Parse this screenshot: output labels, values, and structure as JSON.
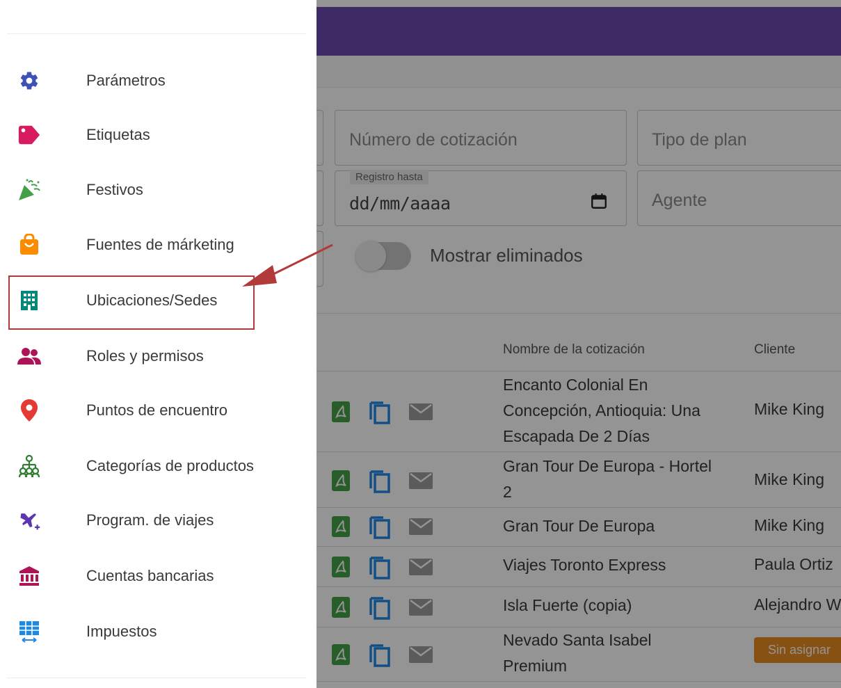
{
  "menu": {
    "items": [
      {
        "label": "Parámetros",
        "icon": "gear-icon",
        "color": "#3f51b5"
      },
      {
        "label": "Etiquetas",
        "icon": "tag-icon",
        "color": "#d81b60"
      },
      {
        "label": "Festivos",
        "icon": "party-popper-icon",
        "color": "#43a047"
      },
      {
        "label": "Fuentes de márketing",
        "icon": "shopping-bag-icon",
        "color": "#fb8c00"
      },
      {
        "label": "Ubicaciones/Sedes",
        "icon": "building-icon",
        "color": "#00897b"
      },
      {
        "label": "Roles y permisos",
        "icon": "people-icon",
        "color": "#ad1457"
      },
      {
        "label": "Puntos de encuentro",
        "icon": "map-pin-icon",
        "color": "#e53935"
      },
      {
        "label": "Categorías de productos",
        "icon": "hierarchy-icon",
        "color": "#2e7d32"
      },
      {
        "label": "Program. de viajes",
        "icon": "airplane-plus-icon",
        "color": "#5e35b1"
      },
      {
        "label": "Cuentas bancarias",
        "icon": "bank-icon",
        "color": "#ad1457"
      },
      {
        "label": "Impuestos",
        "icon": "table-arrows-icon",
        "color": "#1e88e5"
      }
    ],
    "highlighted": "Ubicaciones/Sedes"
  },
  "filters": {
    "quote_number_placeholder": "Número de cotización",
    "plan_type_placeholder": "Tipo de plan",
    "registry_until_label": "Registro hasta",
    "registry_until_value": "dd/mm/aaaa",
    "agent_placeholder": "Agente",
    "show_deleted_label": "Mostrar eliminados"
  },
  "table": {
    "columns": [
      "Nombre de la cotización",
      "Cliente"
    ],
    "rows": [
      {
        "name": "Encanto Colonial En Concepción, Antioquia: Una Escapada De 2 Días",
        "client": "Mike King"
      },
      {
        "name": "Gran Tour De Europa - Hortel 2",
        "client": "Mike King"
      },
      {
        "name": "Gran Tour De Europa",
        "client": "Mike King"
      },
      {
        "name": "Viajes Toronto Express",
        "client": "Paula Ortiz"
      },
      {
        "name": "Isla Fuerte (copia)",
        "client": "Alejandro W"
      },
      {
        "name": "Nevado Santa Isabel Premium",
        "client": "Sin asignar",
        "client_badge": true
      }
    ]
  },
  "colors": {
    "appbar": "#6b4bb0",
    "highlight_border": "#b23a3a",
    "pdf_icon": "#43a047",
    "copy_icon": "#1e88e5",
    "email_icon": "#9e9e9e",
    "badge": "#e88c22"
  }
}
